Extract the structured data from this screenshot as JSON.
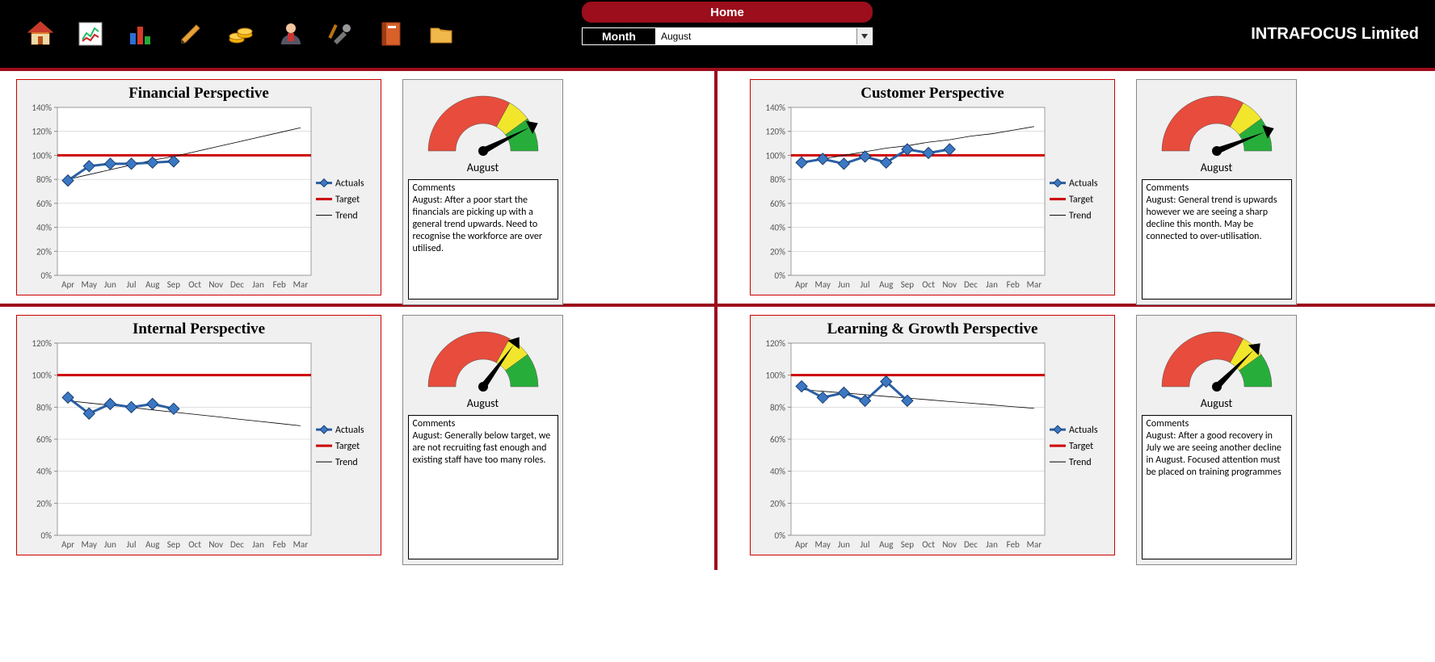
{
  "header": {
    "home_label": "Home",
    "month_label": "Month",
    "month_selected": "August",
    "brand": "INTRAFOCUS Limited",
    "icons": [
      "home-icon",
      "report-icon",
      "chart-icon",
      "pencil-icon",
      "coins-icon",
      "person-icon",
      "tools-icon",
      "notebook-icon",
      "folder-icon"
    ]
  },
  "axes": {
    "months": [
      "Apr",
      "May",
      "Jun",
      "Jul",
      "Aug",
      "Sep",
      "Oct",
      "Nov",
      "Dec",
      "Jan",
      "Feb",
      "Mar"
    ],
    "legend": {
      "actuals": "Actuals",
      "target": "Target",
      "trend": "Trend"
    }
  },
  "comments_label": "Comments",
  "panels": [
    {
      "id": "financial",
      "title": "Financial Perspective",
      "gauge_label": "August",
      "gauge_pct": 85,
      "comment": "August: After a poor start the financials are picking up with a general trend upwards.  Need to recognise the workforce are over utilised.",
      "yticks": [
        "0%",
        "20%",
        "40%",
        "60%",
        "80%",
        "100%",
        "120%",
        "140%"
      ],
      "ymax": 140,
      "target": 100,
      "actuals": [
        79,
        91,
        93,
        93,
        94,
        95
      ],
      "trend": [
        80,
        84,
        88,
        92,
        96,
        99,
        103,
        107,
        111,
        115,
        119,
        123
      ]
    },
    {
      "id": "customer",
      "title": "Customer Perspective",
      "gauge_label": "August",
      "gauge_pct": 88,
      "comment": "August: General trend is upwards however we are seeing a sharp decline this month.  May be connected to over-utilisation.",
      "yticks": [
        "0%",
        "20%",
        "40%",
        "60%",
        "80%",
        "100%",
        "120%",
        "140%"
      ],
      "ymax": 140,
      "target": 100,
      "actuals": [
        94,
        97,
        93,
        99,
        94,
        105,
        102,
        105
      ],
      "trend": [
        94,
        97,
        100,
        103,
        106,
        108,
        111,
        113,
        116,
        118,
        121,
        124
      ]
    },
    {
      "id": "internal",
      "title": "Internal Perspective",
      "gauge_label": "August",
      "gauge_pct": 70,
      "comment": "August: Generally below target, we are not recruiting fast enough and existing staff have too many roles.",
      "yticks": [
        "0%",
        "20%",
        "40%",
        "60%",
        "80%",
        "100%",
        "120%"
      ],
      "ymax": 120,
      "target": 100,
      "actuals": [
        86,
        76,
        82,
        80,
        82,
        79
      ],
      "trend": [
        84,
        82.6,
        81.2,
        79.8,
        78.3,
        76.9,
        75.5,
        74.1,
        72.6,
        71.2,
        69.8,
        68.4
      ]
    },
    {
      "id": "learning",
      "title": "Learning & Growth Perspective",
      "gauge_label": "August",
      "gauge_pct": 75,
      "comment": "August: After a good recovery in July we are seeing another decline in August.  Focused attention must be placed on training programmes",
      "yticks": [
        "0%",
        "20%",
        "40%",
        "60%",
        "80%",
        "100%",
        "120%"
      ],
      "ymax": 120,
      "target": 100,
      "actuals": [
        93,
        86,
        89,
        84,
        96,
        84
      ],
      "trend": [
        91,
        89.9,
        88.9,
        87.8,
        86.7,
        85.7,
        84.6,
        83.5,
        82.5,
        81.4,
        80.3,
        79.3
      ]
    }
  ],
  "chart_data": [
    {
      "type": "line",
      "title": "Financial Perspective",
      "xlabel": "",
      "ylabel": "",
      "ylim": [
        0,
        140
      ],
      "categories": [
        "Apr",
        "May",
        "Jun",
        "Jul",
        "Aug",
        "Sep",
        "Oct",
        "Nov",
        "Dec",
        "Jan",
        "Feb",
        "Mar"
      ],
      "series": [
        {
          "name": "Actuals",
          "values": [
            79,
            91,
            93,
            93,
            94,
            95,
            null,
            null,
            null,
            null,
            null,
            null
          ]
        },
        {
          "name": "Target",
          "values": [
            100,
            100,
            100,
            100,
            100,
            100,
            100,
            100,
            100,
            100,
            100,
            100
          ]
        },
        {
          "name": "Trend",
          "values": [
            80,
            84,
            88,
            92,
            96,
            99,
            103,
            107,
            111,
            115,
            119,
            123
          ]
        }
      ]
    },
    {
      "type": "line",
      "title": "Customer Perspective",
      "xlabel": "",
      "ylabel": "",
      "ylim": [
        0,
        140
      ],
      "categories": [
        "Apr",
        "May",
        "Jun",
        "Jul",
        "Aug",
        "Sep",
        "Oct",
        "Nov",
        "Dec",
        "Jan",
        "Feb",
        "Mar"
      ],
      "series": [
        {
          "name": "Actuals",
          "values": [
            94,
            97,
            93,
            99,
            94,
            105,
            102,
            105,
            null,
            null,
            null,
            null
          ]
        },
        {
          "name": "Target",
          "values": [
            100,
            100,
            100,
            100,
            100,
            100,
            100,
            100,
            100,
            100,
            100,
            100
          ]
        },
        {
          "name": "Trend",
          "values": [
            94,
            97,
            100,
            103,
            106,
            108,
            111,
            113,
            116,
            118,
            121,
            124
          ]
        }
      ]
    },
    {
      "type": "line",
      "title": "Internal Perspective",
      "xlabel": "",
      "ylabel": "",
      "ylim": [
        0,
        120
      ],
      "categories": [
        "Apr",
        "May",
        "Jun",
        "Jul",
        "Aug",
        "Sep",
        "Oct",
        "Nov",
        "Dec",
        "Jan",
        "Feb",
        "Mar"
      ],
      "series": [
        {
          "name": "Actuals",
          "values": [
            86,
            76,
            82,
            80,
            82,
            79,
            null,
            null,
            null,
            null,
            null,
            null
          ]
        },
        {
          "name": "Target",
          "values": [
            100,
            100,
            100,
            100,
            100,
            100,
            100,
            100,
            100,
            100,
            100,
            100
          ]
        },
        {
          "name": "Trend",
          "values": [
            84,
            82.6,
            81.2,
            79.8,
            78.3,
            76.9,
            75.5,
            74.1,
            72.6,
            71.2,
            69.8,
            68.4
          ]
        }
      ]
    },
    {
      "type": "line",
      "title": "Learning & Growth Perspective",
      "xlabel": "",
      "ylabel": "",
      "ylim": [
        0,
        120
      ],
      "categories": [
        "Apr",
        "May",
        "Jun",
        "Jul",
        "Aug",
        "Sep",
        "Oct",
        "Nov",
        "Dec",
        "Jan",
        "Feb",
        "Mar"
      ],
      "series": [
        {
          "name": "Actuals",
          "values": [
            93,
            86,
            89,
            84,
            96,
            84,
            null,
            null,
            null,
            null,
            null,
            null
          ]
        },
        {
          "name": "Target",
          "values": [
            100,
            100,
            100,
            100,
            100,
            100,
            100,
            100,
            100,
            100,
            100,
            100
          ]
        },
        {
          "name": "Trend",
          "values": [
            91,
            89.9,
            88.9,
            87.8,
            86.7,
            85.7,
            84.6,
            83.5,
            82.5,
            81.4,
            80.3,
            79.3
          ]
        }
      ]
    }
  ]
}
